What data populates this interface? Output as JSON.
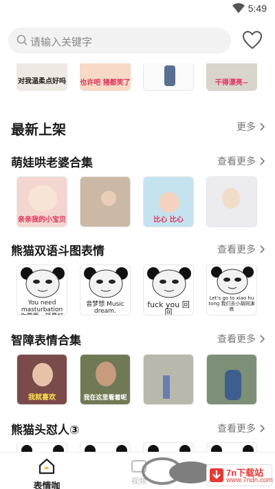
{
  "status_bar": {
    "time": "5:49"
  },
  "search": {
    "placeholder": "请输入关键字"
  },
  "top_strip": {
    "captions": [
      "对我温柔点好吗",
      "也许吧 猪都笑了",
      "",
      "干得漂亮~"
    ]
  },
  "sections": {
    "new_release": {
      "title": "最新上架",
      "more": "更多"
    },
    "s1": {
      "title": "萌娃哄老婆合集",
      "more": "查看更多",
      "captions": [
        "亲亲我的小宝贝",
        "",
        "比心 比心",
        ""
      ]
    },
    "s2": {
      "title": "熊猫双语斗图表情",
      "more": "查看更多",
      "captions": [
        "You need masturbation 你需要一顿暴扛",
        "音梦想 Music dream.",
        "fuck you 回回",
        "Let's go to xiao hu tong 我们去小胡同演练"
      ]
    },
    "s3": {
      "title": "智障表情合集",
      "more": "查看更多",
      "captions": [
        "我就喜欢",
        "我在这里看着呢",
        "",
        ""
      ]
    },
    "s4": {
      "title": "熊猫头怼人③",
      "more": "查看更多"
    }
  },
  "bottom_nav": {
    "home_label": "表情咖",
    "video_label": "视频"
  },
  "promo": {
    "text": "7n下载站",
    "sub": "www.7ndn.com"
  }
}
